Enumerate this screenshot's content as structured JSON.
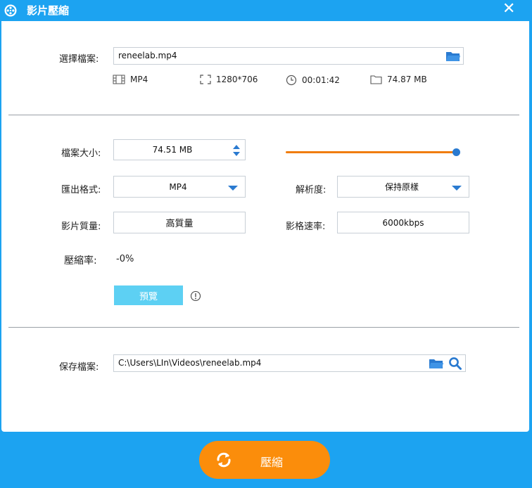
{
  "window": {
    "title": "影片壓縮",
    "close_glyph": "✕"
  },
  "source": {
    "label": "選擇檔案:",
    "value": "reneelab.mp4",
    "folder_icon": "folder-open-icon",
    "info": {
      "format": "MP4",
      "resolution": "1280*706",
      "duration": "00:01:42",
      "size": "74.87 MB"
    }
  },
  "settings": {
    "file_size_label": "檔案大小:",
    "file_size_value": "74.51 MB",
    "slider_level": 1.0,
    "output_format_label": "匯出格式:",
    "output_format_value": "MP4",
    "resolution_label": "解析度:",
    "resolution_value": "保持原樣",
    "quality_label": "影片質量:",
    "quality_value": "高質量",
    "bitrate_label": "影格速率:",
    "bitrate_value": "6000kbps",
    "ratio_label": "壓縮率:",
    "ratio_value": "-0%",
    "preview_label": "預覽"
  },
  "save": {
    "label": "保存檔案:",
    "value": "C:\\Users\\LIn\\Videos\\reneelab.mp4"
  },
  "actions": {
    "compress_label": "壓縮"
  },
  "colors": {
    "accent": "#1ca3f1",
    "orange": "#fb8d0b",
    "preview": "#5dd0f3",
    "slider": "#f07d0e",
    "knob": "#2a7ad0"
  }
}
